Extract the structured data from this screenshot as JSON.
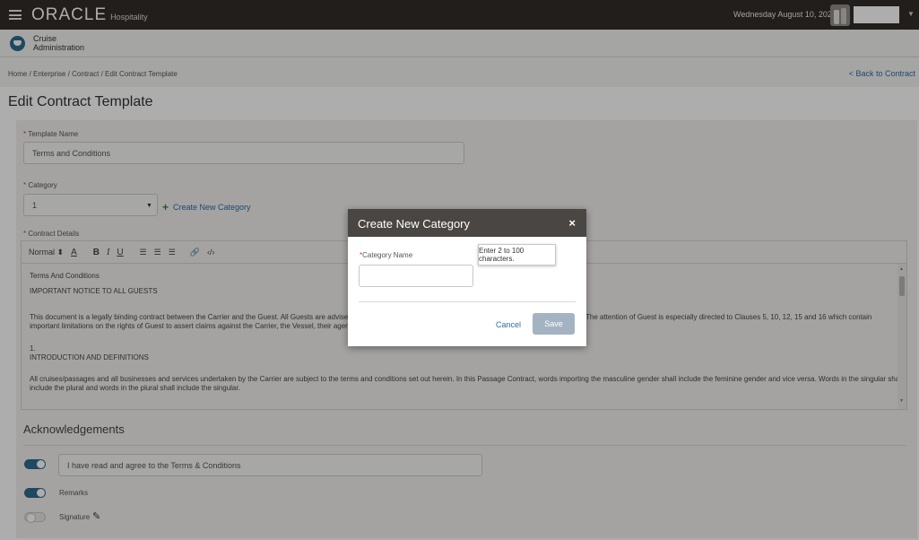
{
  "header": {
    "brand": "ORACLE",
    "brand_sub": "Hospitality",
    "date": "Wednesday August 10, 2022"
  },
  "module": {
    "line1": "Cruise",
    "line2": "Administration"
  },
  "breadcrumb": "Home / Enterprise / Contract / Edit Contract Template",
  "back_link": "< Back to Contract",
  "page_title": "Edit Contract Template",
  "form": {
    "template_name_label": "Template Name",
    "template_name_value": "Terms and Conditions",
    "category_label": "Category",
    "category_value": "1",
    "create_category_link": "Create New Category",
    "contract_details_label": "Contract Details"
  },
  "editor": {
    "toolbar": {
      "format": "Normal",
      "bold": "B",
      "italic": "I",
      "underline": "U",
      "color": "A"
    },
    "lines": [
      "Terms And Conditions",
      "IMPORTANT NOTICE TO ALL GUESTS",
      "This document is a legally binding contract between the Carrier and the Guest. All Guests are advised t",
      "The attention of Guest is especially directed to Clauses 5, 10, 12, 15 and 16 which contain",
      "important limitations on the rights of Guest to assert claims against the Carrier, the Vessel, their agents a",
      "1.",
      "INTRODUCTION AND DEFINITIONS",
      "All cruises/passages and all businesses and services undertaken by the Carrier are subject to the terms and conditions set out herein. In this Passage Contract, words importing the masculine gender shall include the feminine gender and vice versa. Words in the singular shall",
      "include the plural and words in the plural shall include the singular."
    ]
  },
  "acknowledgements": {
    "title": "Acknowledgements",
    "agree_text": "I have read and agree to the Terms & Conditions",
    "remarks": "Remarks",
    "signature": "Signature"
  },
  "modal": {
    "title": "Create New Category",
    "close": "×",
    "field_label": "Category Name",
    "tooltip": "Enter 2 to 100 characters.",
    "cancel": "Cancel",
    "save": "Save"
  }
}
